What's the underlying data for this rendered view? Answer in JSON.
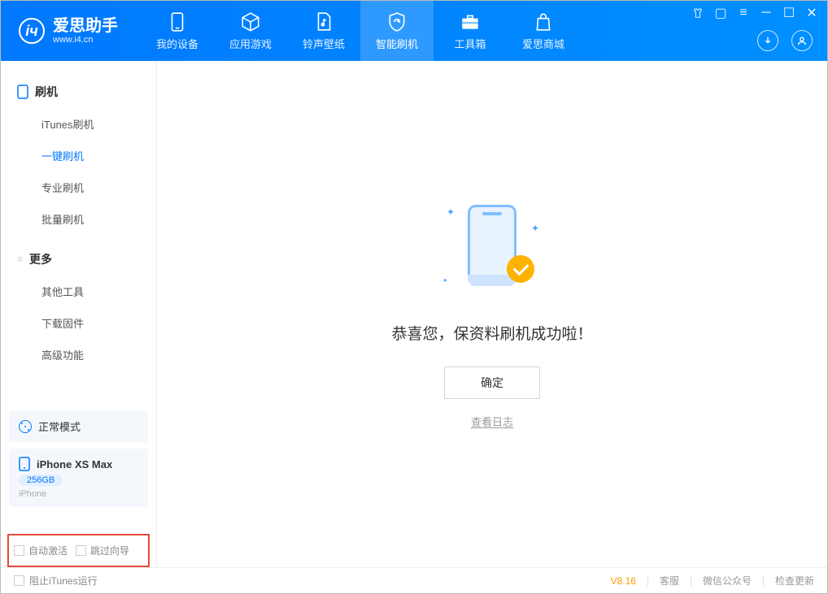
{
  "logo": {
    "title": "爱思助手",
    "sub": "www.i4.cn"
  },
  "tabs": [
    {
      "label": "我的设备"
    },
    {
      "label": "应用游戏"
    },
    {
      "label": "铃声壁纸"
    },
    {
      "label": "智能刷机"
    },
    {
      "label": "工具箱"
    },
    {
      "label": "爱思商城"
    }
  ],
  "sidebar": {
    "sec1": {
      "title": "刷机",
      "items": [
        "iTunes刷机",
        "一键刷机",
        "专业刷机",
        "批量刷机"
      ]
    },
    "sec2": {
      "title": "更多",
      "items": [
        "其他工具",
        "下载固件",
        "高级功能"
      ]
    }
  },
  "device": {
    "mode": "正常模式",
    "name": "iPhone XS Max",
    "storage": "256GB",
    "type": "iPhone"
  },
  "options": {
    "auto_activate": "自动激活",
    "skip_guide": "跳过向导"
  },
  "main": {
    "msg": "恭喜您，保资料刷机成功啦！",
    "confirm": "确定",
    "log": "查看日志"
  },
  "footer": {
    "stop_itunes": "阻止iTunes运行",
    "version": "V8.16",
    "support": "客服",
    "wechat": "微信公众号",
    "update": "检查更新"
  }
}
